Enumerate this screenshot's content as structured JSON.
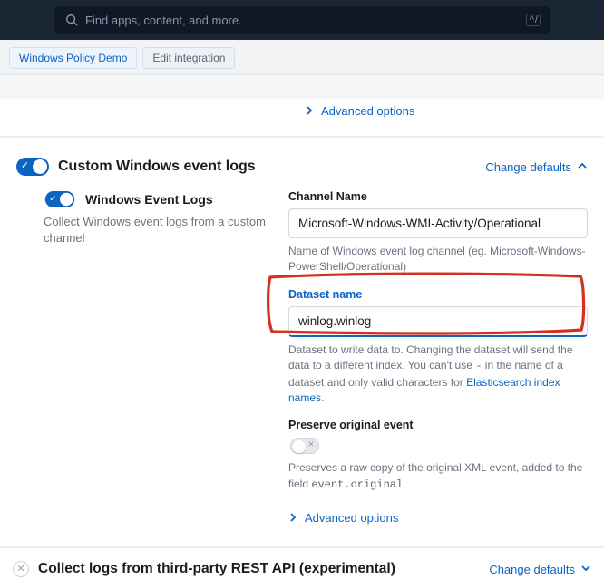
{
  "search": {
    "placeholder": "Find apps, content, and more.",
    "kbd": "^ /"
  },
  "breadcrumb": {
    "a": "Windows Policy Demo",
    "b": "Edit integration"
  },
  "advanced_options": "Advanced options",
  "section_custom": {
    "title": "Custom Windows event logs",
    "change": "Change defaults"
  },
  "sub_eventlogs": {
    "title": "Windows Event Logs",
    "desc": "Collect Windows event logs from a custom channel"
  },
  "channel": {
    "label": "Channel Name",
    "value": "Microsoft-Windows-WMI-Activity/Operational",
    "help": "Name of Windows event log channel (eg. Microsoft-Windows-PowerShell/Operational)"
  },
  "dataset": {
    "label": "Dataset name",
    "value": "winlog.winlog",
    "help_pre": "Dataset to write data to. Changing the dataset will send the data to a different index. You can't use ",
    "help_dash": "-",
    "help_mid": " in the name of a dataset and only valid characters for ",
    "help_link": "Elasticsearch index names",
    "help_post": "."
  },
  "preserve": {
    "label": "Preserve original event",
    "help_a": "Preserves a raw copy of the original XML event, added to the field ",
    "help_code": "event.original"
  },
  "section_rest": {
    "title": "Collect logs from third-party REST API (experimental)",
    "change": "Change defaults"
  }
}
